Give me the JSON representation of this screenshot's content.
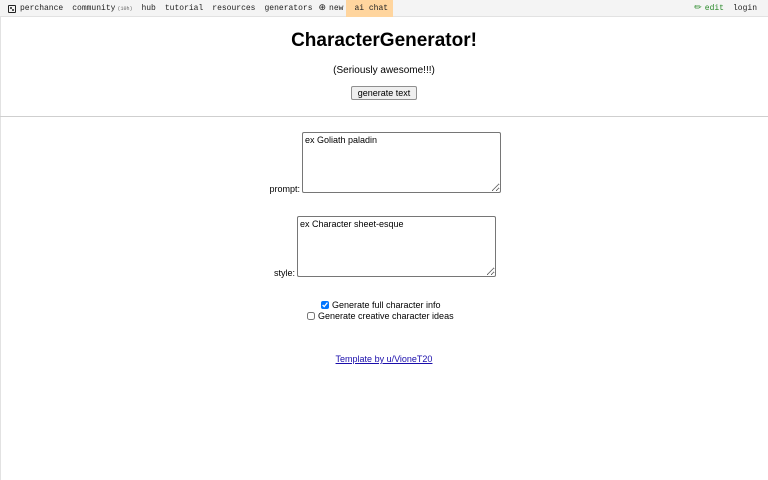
{
  "nav": {
    "items": [
      {
        "icon": "",
        "label": "perchance"
      },
      {
        "icon": "",
        "label": "community",
        "badge": "(10h)"
      },
      {
        "icon": "",
        "label": "hub"
      },
      {
        "icon": "",
        "label": "tutorial"
      },
      {
        "icon": "",
        "label": "resources"
      },
      {
        "icon": "",
        "label": "generators"
      },
      {
        "icon": "⊕",
        "label": "new"
      },
      {
        "icon": "",
        "label": "ai chat"
      }
    ],
    "right": [
      {
        "icon": "✏",
        "label": "edit"
      },
      {
        "icon": "",
        "label": "login"
      }
    ]
  },
  "page": {
    "title": "CharacterGenerator!",
    "subtitle": "(Seriously awesome!!!)",
    "generate_label": "generate text"
  },
  "form": {
    "prompt_label": "prompt:",
    "prompt_value": "ex Goliath paladin",
    "style_label": "style:",
    "style_value": "ex Character sheet-esque",
    "options": [
      {
        "label": "Generate full character info",
        "checked": true
      },
      {
        "label": "Generate creative character ideas",
        "checked": false
      }
    ]
  },
  "footer": {
    "credit_link": "Template by u/VioneT20"
  }
}
